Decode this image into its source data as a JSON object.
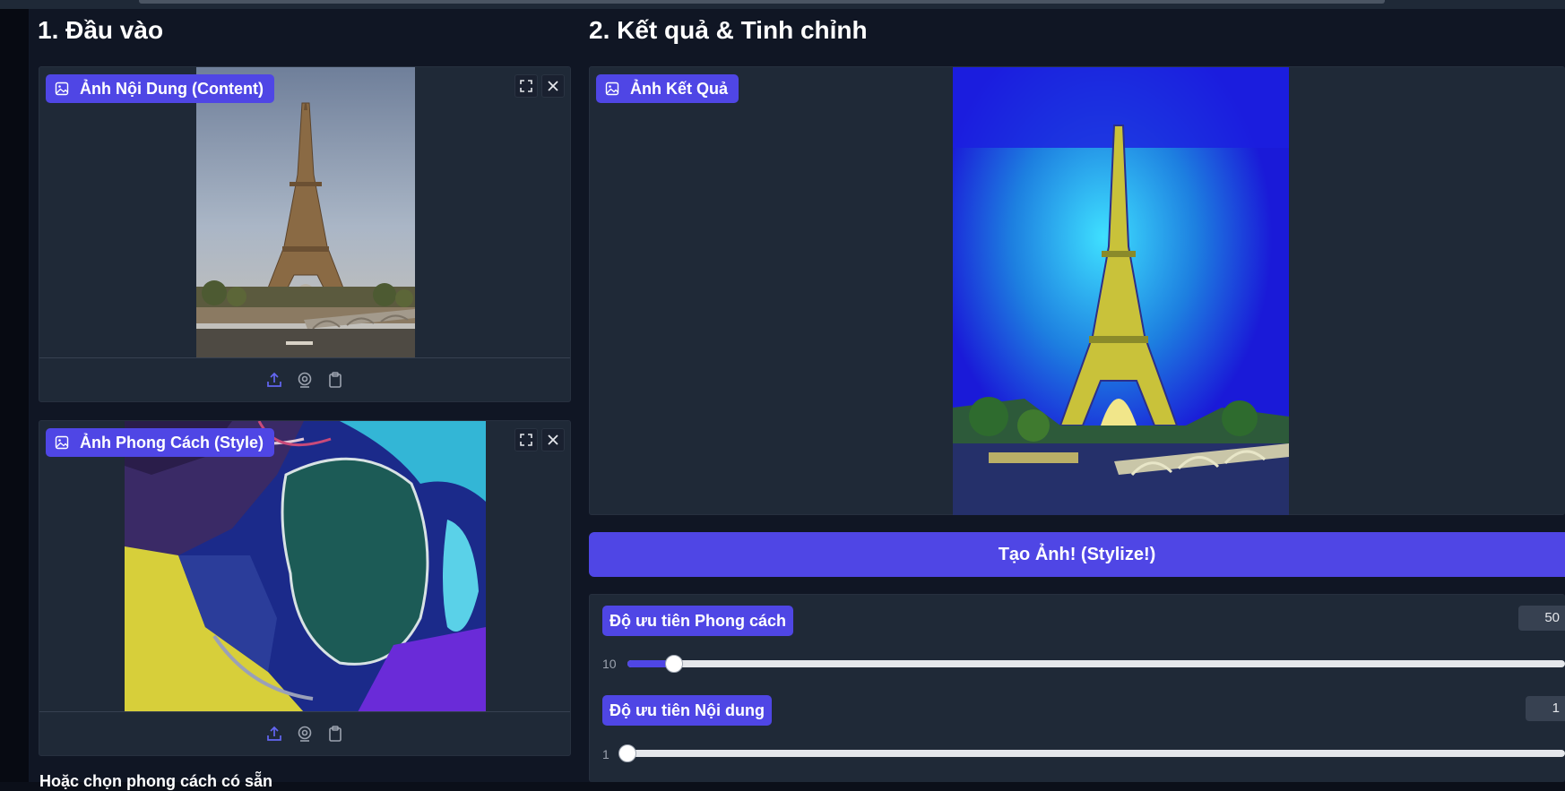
{
  "sections": {
    "input_title": "1. Đầu vào",
    "result_title": "2. Kết quả & Tinh chỉnh"
  },
  "content_panel": {
    "label": "Ảnh Nội Dung (Content)",
    "icon": "image-icon"
  },
  "style_panel": {
    "label": "Ảnh Phong Cách (Style)",
    "icon": "image-icon"
  },
  "result_panel": {
    "label": "Ảnh Kết Quả",
    "icon": "image-icon"
  },
  "footer_icons": [
    "upload-icon",
    "webcam-icon",
    "clipboard-icon"
  ],
  "stylize_button": "Tạo Ảnh! (Stylize!)",
  "sliders": [
    {
      "label": "Độ ưu tiên Phong cách",
      "value": "50",
      "min": "10"
    },
    {
      "label": "Độ ưu tiên Nội dung",
      "value": "1",
      "min": "1"
    }
  ],
  "presets_heading": "Hoặc chọn phong cách có sẵn",
  "colors": {
    "accent": "#4f46e5",
    "panel": "#1f2937",
    "background": "#101624"
  }
}
